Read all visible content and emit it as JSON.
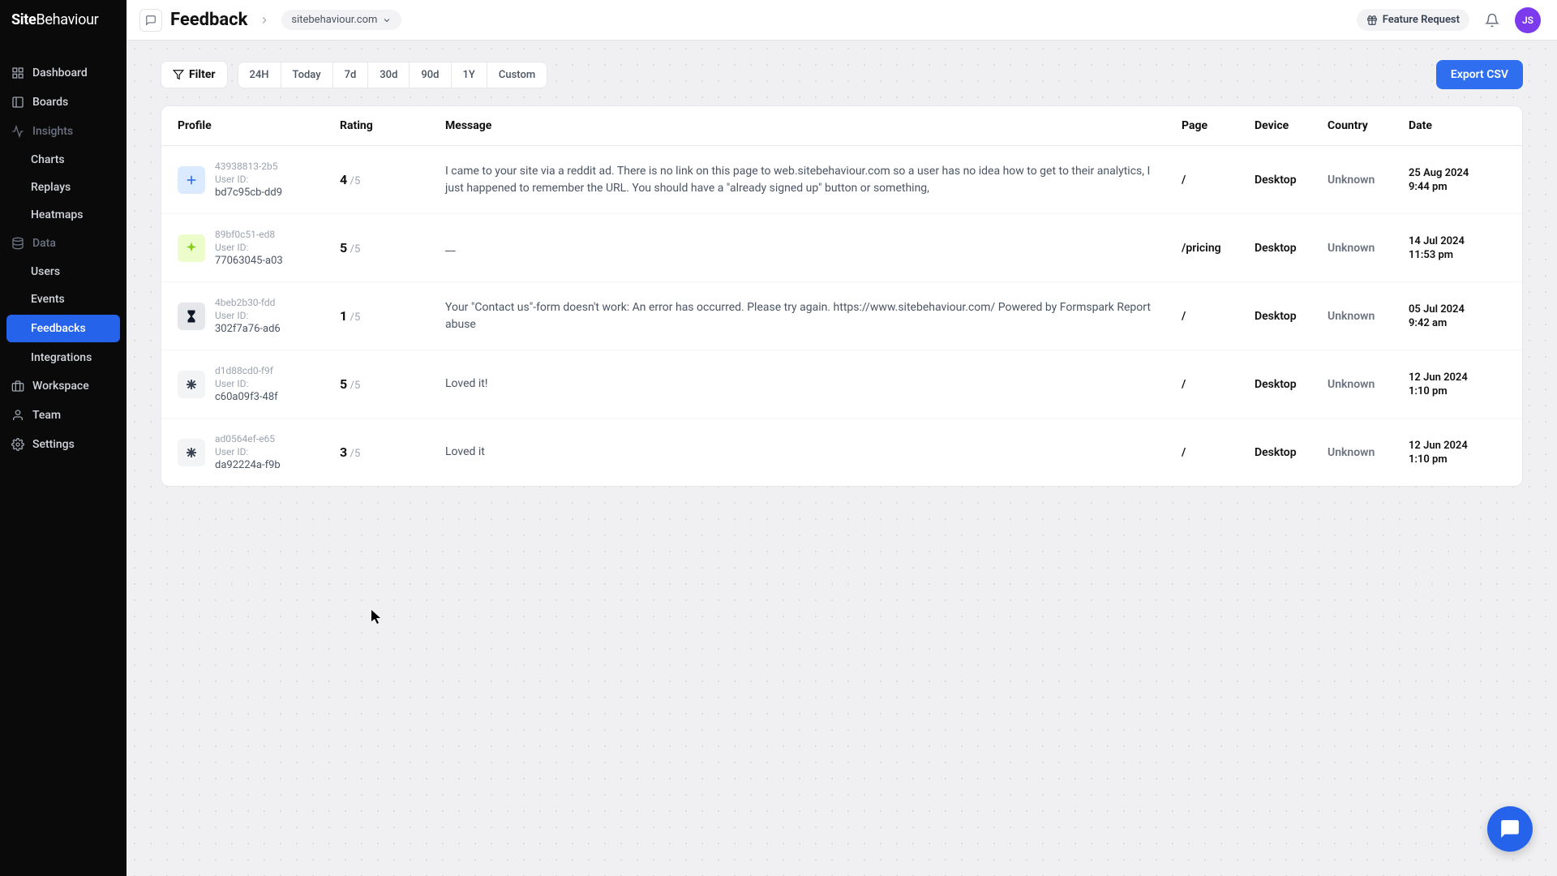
{
  "logo": {
    "bold": "Site",
    "light": "Behaviour"
  },
  "header": {
    "title": "Feedback",
    "site": "sitebehaviour.com",
    "feature_request": "Feature Request",
    "avatar_initials": "JS"
  },
  "sidebar": {
    "dashboard": "Dashboard",
    "boards": "Boards",
    "insights": "Insights",
    "charts": "Charts",
    "replays": "Replays",
    "heatmaps": "Heatmaps",
    "data": "Data",
    "users": "Users",
    "events": "Events",
    "feedbacks": "Feedbacks",
    "integrations": "Integrations",
    "workspace": "Workspace",
    "team": "Team",
    "settings": "Settings"
  },
  "toolbar": {
    "filter": "Filter",
    "ranges": [
      "24H",
      "Today",
      "7d",
      "30d",
      "90d",
      "1Y",
      "Custom"
    ],
    "export": "Export CSV"
  },
  "table": {
    "headers": {
      "profile": "Profile",
      "rating": "Rating",
      "message": "Message",
      "page": "Page",
      "device": "Device",
      "country": "Country",
      "date": "Date"
    },
    "rows": [
      {
        "avatar_bg": "#dbeafe",
        "avatar_fg": "#2563eb",
        "avatar_glyph": "plus",
        "session_id": "43938813-2b5",
        "user_id_label": "User ID:",
        "user_id": "bd7c95cb-dd9",
        "rating": "4",
        "rating_denom": "/5",
        "message": "I came to your site via a reddit ad. There is no link on this page to web.sitebehaviour.com so a user has no idea how to get to their analytics, I just happened to remember the URL. You should have a \"already signed up\" button or something,",
        "page": "/",
        "device": "Desktop",
        "country": "Unknown",
        "date": "25 Aug 2024",
        "time": "9:44 pm"
      },
      {
        "avatar_bg": "#ecfccb",
        "avatar_fg": "#84cc16",
        "avatar_glyph": "sparkle",
        "session_id": "89bf0c51-ed8",
        "user_id_label": "User ID:",
        "user_id": "77063045-a03",
        "rating": "5",
        "rating_denom": "/5",
        "message": "__",
        "page": "/pricing",
        "device": "Desktop",
        "country": "Unknown",
        "date": "14 Jul 2024",
        "time": "11:53 pm"
      },
      {
        "avatar_bg": "#e5e7eb",
        "avatar_fg": "#111827",
        "avatar_glyph": "hourglass",
        "session_id": "4beb2b30-fdd",
        "user_id_label": "User ID:",
        "user_id": "302f7a76-ad6",
        "rating": "1",
        "rating_denom": "/5",
        "message": "Your \"Contact us\"-form doesn't work: An error has occurred. Please try again. https://www.sitebehaviour.com/ Powered by Formspark Report abuse",
        "page": "/",
        "device": "Desktop",
        "country": "Unknown",
        "date": "05 Jul 2024",
        "time": "9:42 am"
      },
      {
        "avatar_bg": "#f3f4f6",
        "avatar_fg": "#374151",
        "avatar_glyph": "asterisk",
        "session_id": "d1d88cd0-f9f",
        "user_id_label": "User ID:",
        "user_id": "c60a09f3-48f",
        "rating": "5",
        "rating_denom": "/5",
        "message": "Loved it!",
        "page": "/",
        "device": "Desktop",
        "country": "Unknown",
        "date": "12 Jun 2024",
        "time": "1:10 pm"
      },
      {
        "avatar_bg": "#f3f4f6",
        "avatar_fg": "#374151",
        "avatar_glyph": "asterisk",
        "session_id": "ad0564ef-e65",
        "user_id_label": "User ID:",
        "user_id": "da92224a-f9b",
        "rating": "3",
        "rating_denom": "/5",
        "message": "Loved it",
        "page": "/",
        "device": "Desktop",
        "country": "Unknown",
        "date": "12 Jun 2024",
        "time": "1:10 pm"
      }
    ]
  }
}
